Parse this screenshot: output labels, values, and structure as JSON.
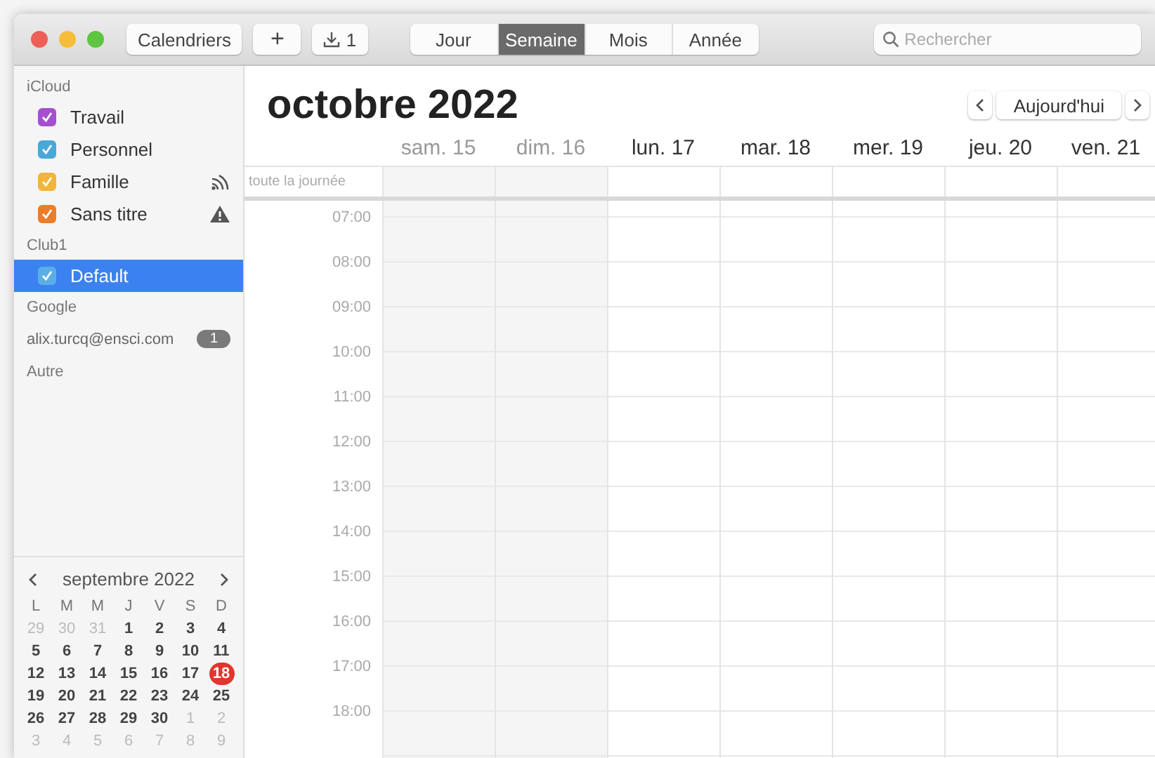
{
  "toolbar": {
    "calendars_button": "Calendriers",
    "add_button": "+",
    "import_count": "1",
    "views": [
      {
        "label": "Jour",
        "selected": false
      },
      {
        "label": "Semaine",
        "selected": true
      },
      {
        "label": "Mois",
        "selected": false
      },
      {
        "label": "Année",
        "selected": false
      }
    ],
    "search": {
      "placeholder": "Rechercher"
    }
  },
  "sidebar": {
    "groups": [
      {
        "title": "iCloud",
        "items": [
          {
            "kind": "calendar",
            "name": "Travail",
            "color": "#a54fd0",
            "checked": true,
            "selected": false,
            "shared": false,
            "warning": false
          },
          {
            "kind": "calendar",
            "name": "Personnel",
            "color": "#4aa8d8",
            "checked": true,
            "selected": false,
            "shared": false,
            "warning": false
          },
          {
            "kind": "calendar",
            "name": "Famille",
            "color": "#f2b43c",
            "checked": true,
            "selected": false,
            "shared": true,
            "warning": false
          },
          {
            "kind": "calendar",
            "name": "Sans titre",
            "color": "#ea7d2c",
            "checked": true,
            "selected": false,
            "shared": false,
            "warning": true
          }
        ]
      },
      {
        "title": "Club1",
        "items": [
          {
            "kind": "calendar",
            "name": "Default",
            "color": "#5aaee6",
            "checked": true,
            "selected": true,
            "shared": false,
            "warning": false
          }
        ]
      },
      {
        "title": "Google",
        "items": [
          {
            "kind": "account",
            "name": "alix.turcq@ensci.com",
            "badge": "1"
          }
        ]
      },
      {
        "title": "Autre"
      }
    ],
    "mini_calendar": {
      "title": "septembre 2022",
      "weekdays": [
        "L",
        "M",
        "M",
        "J",
        "V",
        "S",
        "D"
      ],
      "weeks": [
        [
          {
            "day": "29",
            "outside": true,
            "today": false
          },
          {
            "day": "30",
            "outside": true,
            "today": false
          },
          {
            "day": "31",
            "outside": true,
            "today": false
          },
          {
            "day": "1",
            "outside": false,
            "today": false
          },
          {
            "day": "2",
            "outside": false,
            "today": false
          },
          {
            "day": "3",
            "outside": false,
            "today": false
          },
          {
            "day": "4",
            "outside": false,
            "today": false
          }
        ],
        [
          {
            "day": "5",
            "outside": false,
            "today": false
          },
          {
            "day": "6",
            "outside": false,
            "today": false
          },
          {
            "day": "7",
            "outside": false,
            "today": false
          },
          {
            "day": "8",
            "outside": false,
            "today": false
          },
          {
            "day": "9",
            "outside": false,
            "today": false
          },
          {
            "day": "10",
            "outside": false,
            "today": false
          },
          {
            "day": "11",
            "outside": false,
            "today": false
          }
        ],
        [
          {
            "day": "12",
            "outside": false,
            "today": false
          },
          {
            "day": "13",
            "outside": false,
            "today": false
          },
          {
            "day": "14",
            "outside": false,
            "today": false
          },
          {
            "day": "15",
            "outside": false,
            "today": false
          },
          {
            "day": "16",
            "outside": false,
            "today": false
          },
          {
            "day": "17",
            "outside": false,
            "today": false
          },
          {
            "day": "18",
            "outside": false,
            "today": true
          }
        ],
        [
          {
            "day": "19",
            "outside": false,
            "today": false
          },
          {
            "day": "20",
            "outside": false,
            "today": false
          },
          {
            "day": "21",
            "outside": false,
            "today": false
          },
          {
            "day": "22",
            "outside": false,
            "today": false
          },
          {
            "day": "23",
            "outside": false,
            "today": false
          },
          {
            "day": "24",
            "outside": false,
            "today": false
          },
          {
            "day": "25",
            "outside": false,
            "today": false
          }
        ],
        [
          {
            "day": "26",
            "outside": false,
            "today": false
          },
          {
            "day": "27",
            "outside": false,
            "today": false
          },
          {
            "day": "28",
            "outside": false,
            "today": false
          },
          {
            "day": "29",
            "outside": false,
            "today": false
          },
          {
            "day": "30",
            "outside": false,
            "today": false
          },
          {
            "day": "1",
            "outside": true,
            "today": false
          },
          {
            "day": "2",
            "outside": true,
            "today": false
          }
        ],
        [
          {
            "day": "3",
            "outside": true,
            "today": false
          },
          {
            "day": "4",
            "outside": true,
            "today": false
          },
          {
            "day": "5",
            "outside": true,
            "today": false
          },
          {
            "day": "6",
            "outside": true,
            "today": false
          },
          {
            "day": "7",
            "outside": true,
            "today": false
          },
          {
            "day": "8",
            "outside": true,
            "today": false
          },
          {
            "day": "9",
            "outside": true,
            "today": false
          }
        ]
      ]
    }
  },
  "week": {
    "title": "octobre 2022",
    "today_button": "Aujourd'hui",
    "all_day_label": "toute la journée",
    "days": [
      {
        "label": "sam. 15",
        "weekend": true
      },
      {
        "label": "dim. 16",
        "weekend": true
      },
      {
        "label": "lun. 17",
        "weekend": false
      },
      {
        "label": "mar. 18",
        "weekend": false
      },
      {
        "label": "mer. 19",
        "weekend": false
      },
      {
        "label": "jeu. 20",
        "weekend": false
      },
      {
        "label": "ven. 21",
        "weekend": false
      }
    ],
    "hours": [
      "07:00",
      "08:00",
      "09:00",
      "10:00",
      "11:00",
      "12:00",
      "13:00",
      "14:00",
      "15:00",
      "16:00",
      "17:00",
      "18:00"
    ]
  }
}
